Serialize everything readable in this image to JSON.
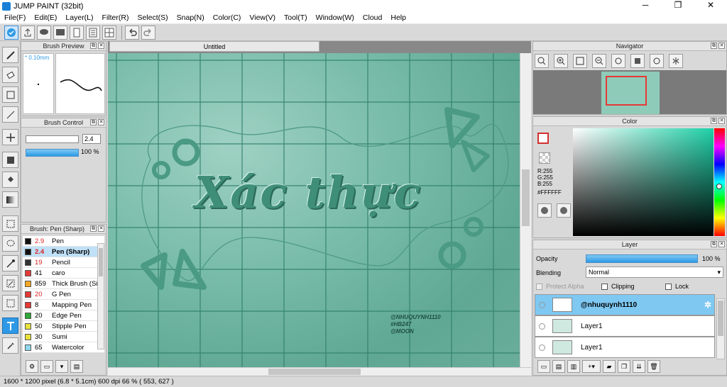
{
  "window": {
    "title": "JUMP PAINT (32bit)",
    "minimize": "─",
    "maximize": "❐",
    "close": "✕"
  },
  "menu": [
    "File(F)",
    "Edit(E)",
    "Layer(L)",
    "Filter(R)",
    "Select(S)",
    "Snap(N)",
    "Color(C)",
    "View(V)",
    "Tool(T)",
    "Window(W)",
    "Cloud",
    "Help"
  ],
  "panels": {
    "brush_preview": {
      "title": "Brush Preview",
      "size": "* 0.10mm"
    },
    "brush_control": {
      "title": "Brush Control",
      "size_value": "2.4",
      "opacity_value": "100 %"
    },
    "brush_list": {
      "title": "Brush: Pen (Sharp)",
      "items": [
        {
          "size": "2.9",
          "name": "Pen",
          "color": "#111111"
        },
        {
          "size": "2.4",
          "name": "Pen (Sharp)",
          "color": "#111111"
        },
        {
          "size": "19",
          "name": "Pencil",
          "color": "#333333"
        },
        {
          "size": "41",
          "name": "caro",
          "color": "#e53935"
        },
        {
          "size": "859",
          "name": "Thick Brush (Si",
          "color": "#f5a623"
        },
        {
          "size": "20",
          "name": "G Pen",
          "color": "#e53935"
        },
        {
          "size": "8",
          "name": "Mapping Pen",
          "color": "#e53935"
        },
        {
          "size": "20",
          "name": "Edge Pen",
          "color": "#2ea836"
        },
        {
          "size": "50",
          "name": "Stipple Pen",
          "color": "#e8e23a"
        },
        {
          "size": "30",
          "name": "Sumi",
          "color": "#e8e23a"
        },
        {
          "size": "65",
          "name": "Watercolor",
          "color": "#8fd8f0"
        }
      ]
    },
    "navigator": {
      "title": "Navigator"
    },
    "color": {
      "title": "Color",
      "r": "R:255",
      "g": "G:255",
      "b": "B:255",
      "hex": "#FFFFFF"
    },
    "layer": {
      "title": "Layer",
      "opacity_label": "Opacity",
      "opacity_value": "100 %",
      "opacity_fraction": 1.0,
      "blending_label": "Blending",
      "blending_value": "Normal",
      "protect_alpha": "Protect Alpha",
      "clipping": "Clipping",
      "lock": "Lock",
      "layers": [
        {
          "name": "@nhuquynh1110",
          "selected": true
        },
        {
          "name": "Layer1",
          "selected": false
        },
        {
          "name": "Layer1",
          "selected": false
        }
      ]
    }
  },
  "document": {
    "tab": "Untitled",
    "art_title": "Xác thực",
    "art_credits": [
      "@NHUQUYNH1110",
      "#HB247",
      "@MOON"
    ]
  },
  "status": {
    "text": "1600 * 1200 pixel   (6.8 * 5.1cm)   600 dpi   66 %   ( 553, 627 )"
  },
  "colors": {
    "accent": "#2e9ae6",
    "canvas_teal": "#79bcaa"
  }
}
